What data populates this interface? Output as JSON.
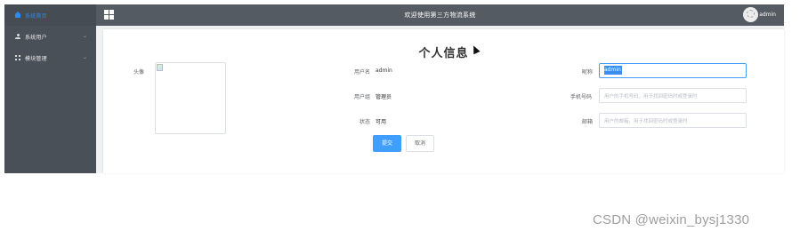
{
  "sidebar": {
    "items": [
      {
        "label": "系统首页",
        "icon": "home-icon",
        "active": true
      },
      {
        "label": "系统用户",
        "icon": "user-icon",
        "expandable": true
      },
      {
        "label": "模块管理",
        "icon": "grid-icon",
        "expandable": true
      }
    ],
    "chevron": "⌄"
  },
  "header": {
    "title": "欢迎使用第三方物流系统",
    "username": "admin",
    "menu_icon": "grid-menu-icon"
  },
  "main": {
    "title": "个人信息",
    "avatar_label": "头像",
    "username_label": "用户名",
    "username_value": "admin",
    "group_label": "用户组",
    "group_value": "管理员",
    "status_label": "状态",
    "status_value": "可用",
    "nickname_label": "昵称",
    "nickname_value": "admin",
    "phone_label": "手机号码",
    "phone_placeholder": "用户的手机号码，用于找回密码时或登录时",
    "email_label": "邮箱",
    "email_placeholder": "用户的邮箱，用于找回密码时或登录时",
    "submit_label": "提交",
    "cancel_label": "取消"
  },
  "watermark": "CSDN @weixin_bysj1330",
  "colors": {
    "sidebar_bg": "#4a5057",
    "header_bg": "#545b62",
    "accent": "#409eff"
  }
}
